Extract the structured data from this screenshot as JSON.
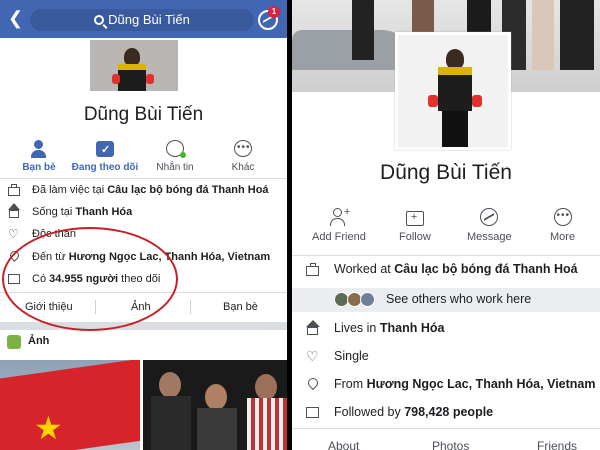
{
  "left": {
    "nav": {
      "search_text": "Dũng Bùi Tiến",
      "messenger_badge": "1"
    },
    "profile_name": "Dũng Bùi Tiến",
    "actions": [
      {
        "label": "Bạn bè",
        "icon": "friends-icon"
      },
      {
        "label": "Đang theo dõi",
        "icon": "following-icon"
      },
      {
        "label": "Nhắn tin",
        "icon": "messenger-icon"
      },
      {
        "label": "Khác",
        "icon": "more-icon"
      }
    ],
    "info": {
      "work_prefix": "Đã làm việc tại ",
      "work_place": "Câu lạc bộ bóng đá Thanh Hoá",
      "lives_prefix": "Sống tại ",
      "lives_place": "Thanh Hóa",
      "relationship": "Độc thân",
      "from_prefix": "Đến từ ",
      "from_place": "Hương Ngọc Lac, Thanh Hóa, Vietnam",
      "followers_prefix": "Có ",
      "followers_count": "34.955 người",
      "followers_suffix": " theo dõi"
    },
    "tabs": [
      "Giới thiệu",
      "Ảnh",
      "Bạn bè"
    ],
    "photos_header": "Ảnh",
    "highlight_color": "#c62026"
  },
  "right": {
    "profile_name": "Dũng Bùi Tiến",
    "actions": [
      {
        "label": "Add Friend",
        "icon": "add-friend-icon"
      },
      {
        "label": "Follow",
        "icon": "follow-icon"
      },
      {
        "label": "Message",
        "icon": "messenger-icon"
      },
      {
        "label": "More",
        "icon": "more-icon"
      }
    ],
    "info": {
      "work_prefix": "Worked at ",
      "work_place": "Câu lạc bộ bóng đá Thanh Hoá",
      "coworkers_text": "See others who work here",
      "lives_prefix": "Lives in ",
      "lives_place": "Thanh Hóa",
      "relationship": "Single",
      "from_prefix": "From ",
      "from_place": "Hương Ngọc Lac, Thanh Hóa, Vietnam",
      "followers_prefix": "Followed by ",
      "followers_count": "798,428 people"
    },
    "tabs": [
      "About",
      "Photos",
      "Friends"
    ]
  },
  "colors": {
    "facebook_blue": "#4267b2",
    "text": "#1c1e21",
    "muted": "#4b4f56"
  }
}
